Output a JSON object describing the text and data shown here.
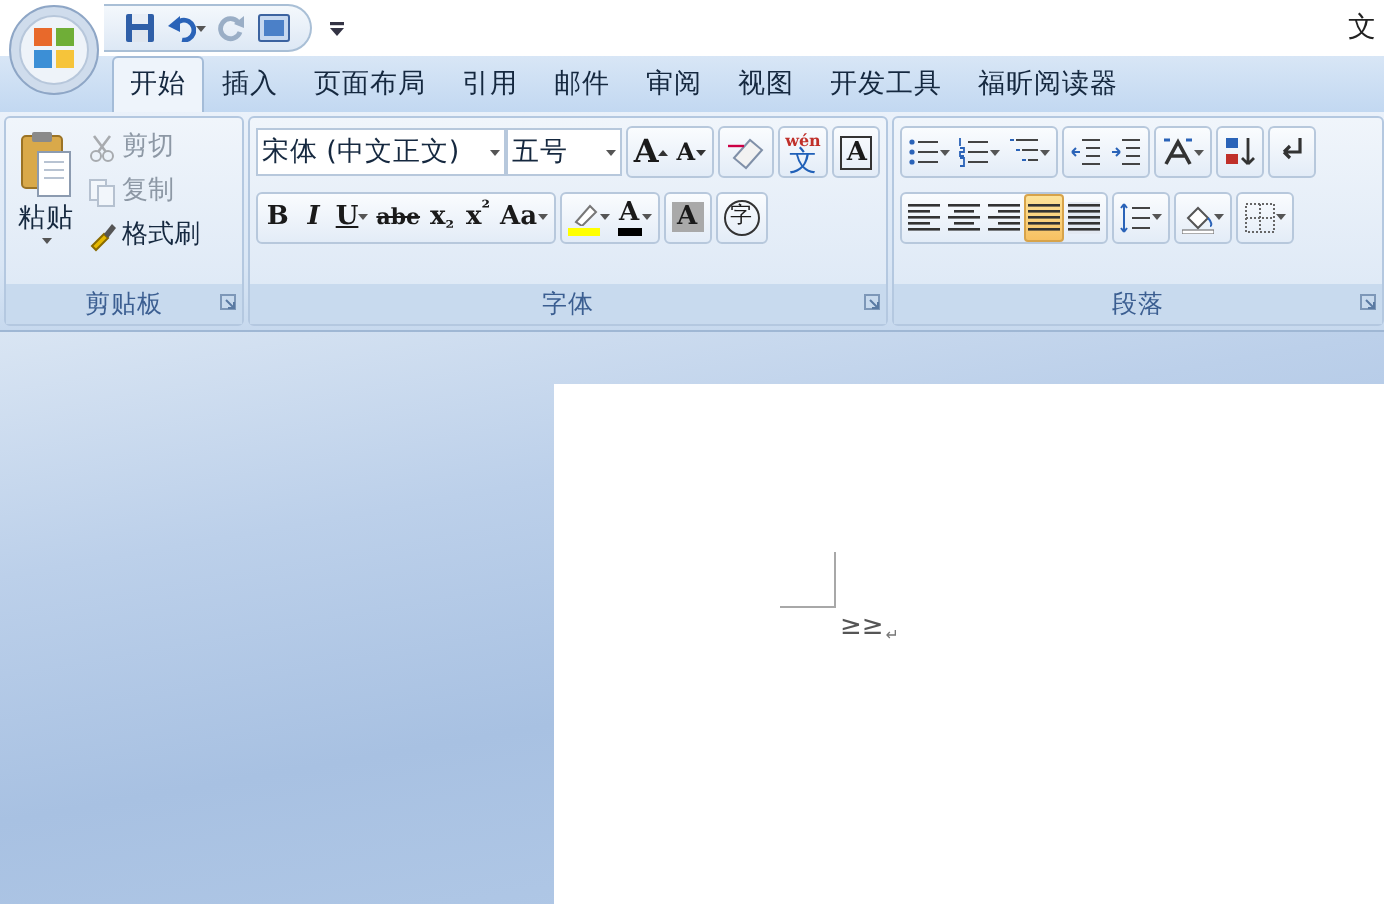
{
  "window": {
    "title": "文"
  },
  "tabs": [
    {
      "label": "开始",
      "selected": true
    },
    {
      "label": "插入",
      "selected": false
    },
    {
      "label": "页面布局",
      "selected": false
    },
    {
      "label": "引用",
      "selected": false
    },
    {
      "label": "邮件",
      "selected": false
    },
    {
      "label": "审阅",
      "selected": false
    },
    {
      "label": "视图",
      "selected": false
    },
    {
      "label": "开发工具",
      "selected": false
    },
    {
      "label": "福昕阅读器",
      "selected": false
    }
  ],
  "clipboard": {
    "label": "剪贴板",
    "paste": "粘贴",
    "items": [
      {
        "kind": "cut",
        "label": "剪切",
        "disabled": true
      },
      {
        "kind": "copy",
        "label": "复制",
        "disabled": true
      },
      {
        "kind": "brush",
        "label": "格式刷",
        "disabled": false
      }
    ]
  },
  "font": {
    "label": "字体",
    "font_name": "宋体 (中文正文)",
    "font_size": "五号",
    "row1": [
      {
        "kind": "grow",
        "text": "A"
      },
      {
        "kind": "shrink",
        "text": "A"
      },
      {
        "kind": "eraser"
      },
      {
        "kind": "phonetic",
        "text": "文",
        "ruby": "wén"
      },
      {
        "kind": "boxed",
        "text": "A"
      }
    ],
    "row2": [
      {
        "kind": "bold",
        "text": "B",
        "has_menu": false
      },
      {
        "kind": "italic",
        "text": "I",
        "has_menu": false
      },
      {
        "kind": "underline",
        "text": "U",
        "has_menu": true
      },
      {
        "kind": "strike",
        "text": "abe",
        "has_menu": false
      },
      {
        "kind": "script",
        "text": "x$_{₂}$",
        "has_menu": false
      },
      {
        "kind": "script",
        "text": "x$^{²}$",
        "has_menu": false
      },
      {
        "kind": "case",
        "text": "Aa",
        "has_menu": true
      },
      {
        "kind": "highlight",
        "has_menu": true,
        "color": "#ffff00"
      },
      {
        "kind": "fontcolor",
        "text": "A",
        "has_menu": true,
        "color": "#000000"
      },
      {
        "kind": "shaded",
        "text": "A",
        "has_menu": false
      },
      {
        "kind": "enclosed",
        "text": "字",
        "has_menu": false
      }
    ]
  },
  "paragraph": {
    "label": "段落",
    "row1": [
      {
        "kind": "bullets",
        "has_menu": true
      },
      {
        "kind": "numbering",
        "has_menu": true
      },
      {
        "kind": "multilevel",
        "has_menu": true
      },
      {
        "kind": "outdent",
        "has_menu": false
      },
      {
        "kind": "indent",
        "has_menu": false
      },
      {
        "kind": "cjk",
        "has_menu": true
      },
      {
        "kind": "sort",
        "has_menu": false
      },
      {
        "kind": "marks",
        "has_menu": false
      }
    ],
    "alignment": [
      {
        "kind": "left",
        "selected": false
      },
      {
        "kind": "center",
        "selected": false
      },
      {
        "kind": "right",
        "selected": false
      },
      {
        "kind": "justify",
        "selected": true
      },
      {
        "kind": "distribute",
        "selected": false
      }
    ],
    "row2": [
      {
        "kind": "spacing",
        "has_menu": true
      },
      {
        "kind": "fill",
        "has_menu": true
      },
      {
        "kind": "borders",
        "has_menu": true
      }
    ]
  },
  "document": {
    "text": "≥≥",
    "paragraph_mark": "↵"
  }
}
